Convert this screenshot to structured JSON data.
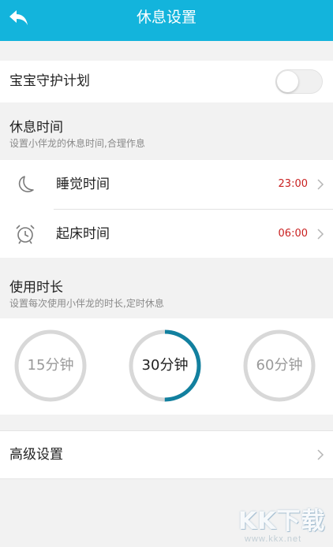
{
  "header": {
    "title": "休息设置",
    "back_icon": "back-arrow-icon"
  },
  "guard": {
    "label": "宝宝守护计划",
    "enabled": false
  },
  "rest_section": {
    "title": "休息时间",
    "subtitle": "设置小伴龙的休息时间,合理作息",
    "items": [
      {
        "label": "睡觉时间",
        "value": "23:00",
        "icon": "moon-icon"
      },
      {
        "label": "起床时间",
        "value": "06:00",
        "icon": "alarm-clock-icon"
      }
    ]
  },
  "duration_section": {
    "title": "使用时长",
    "subtitle": "设置每次使用小伴龙的时长,定时休息",
    "options": [
      {
        "label": "15分钟",
        "selected": false
      },
      {
        "label": "30分钟",
        "selected": true,
        "progress": 0.5
      },
      {
        "label": "60分钟",
        "selected": false
      }
    ]
  },
  "advanced": {
    "label": "高级设置"
  },
  "watermark": {
    "main": "KK下载",
    "sub": "www.kkx.net"
  },
  "colors": {
    "header": "#13b4dc",
    "time_value": "#c91f1f",
    "ring_active": "#12809f",
    "ring_track": "#d8d8d8"
  }
}
